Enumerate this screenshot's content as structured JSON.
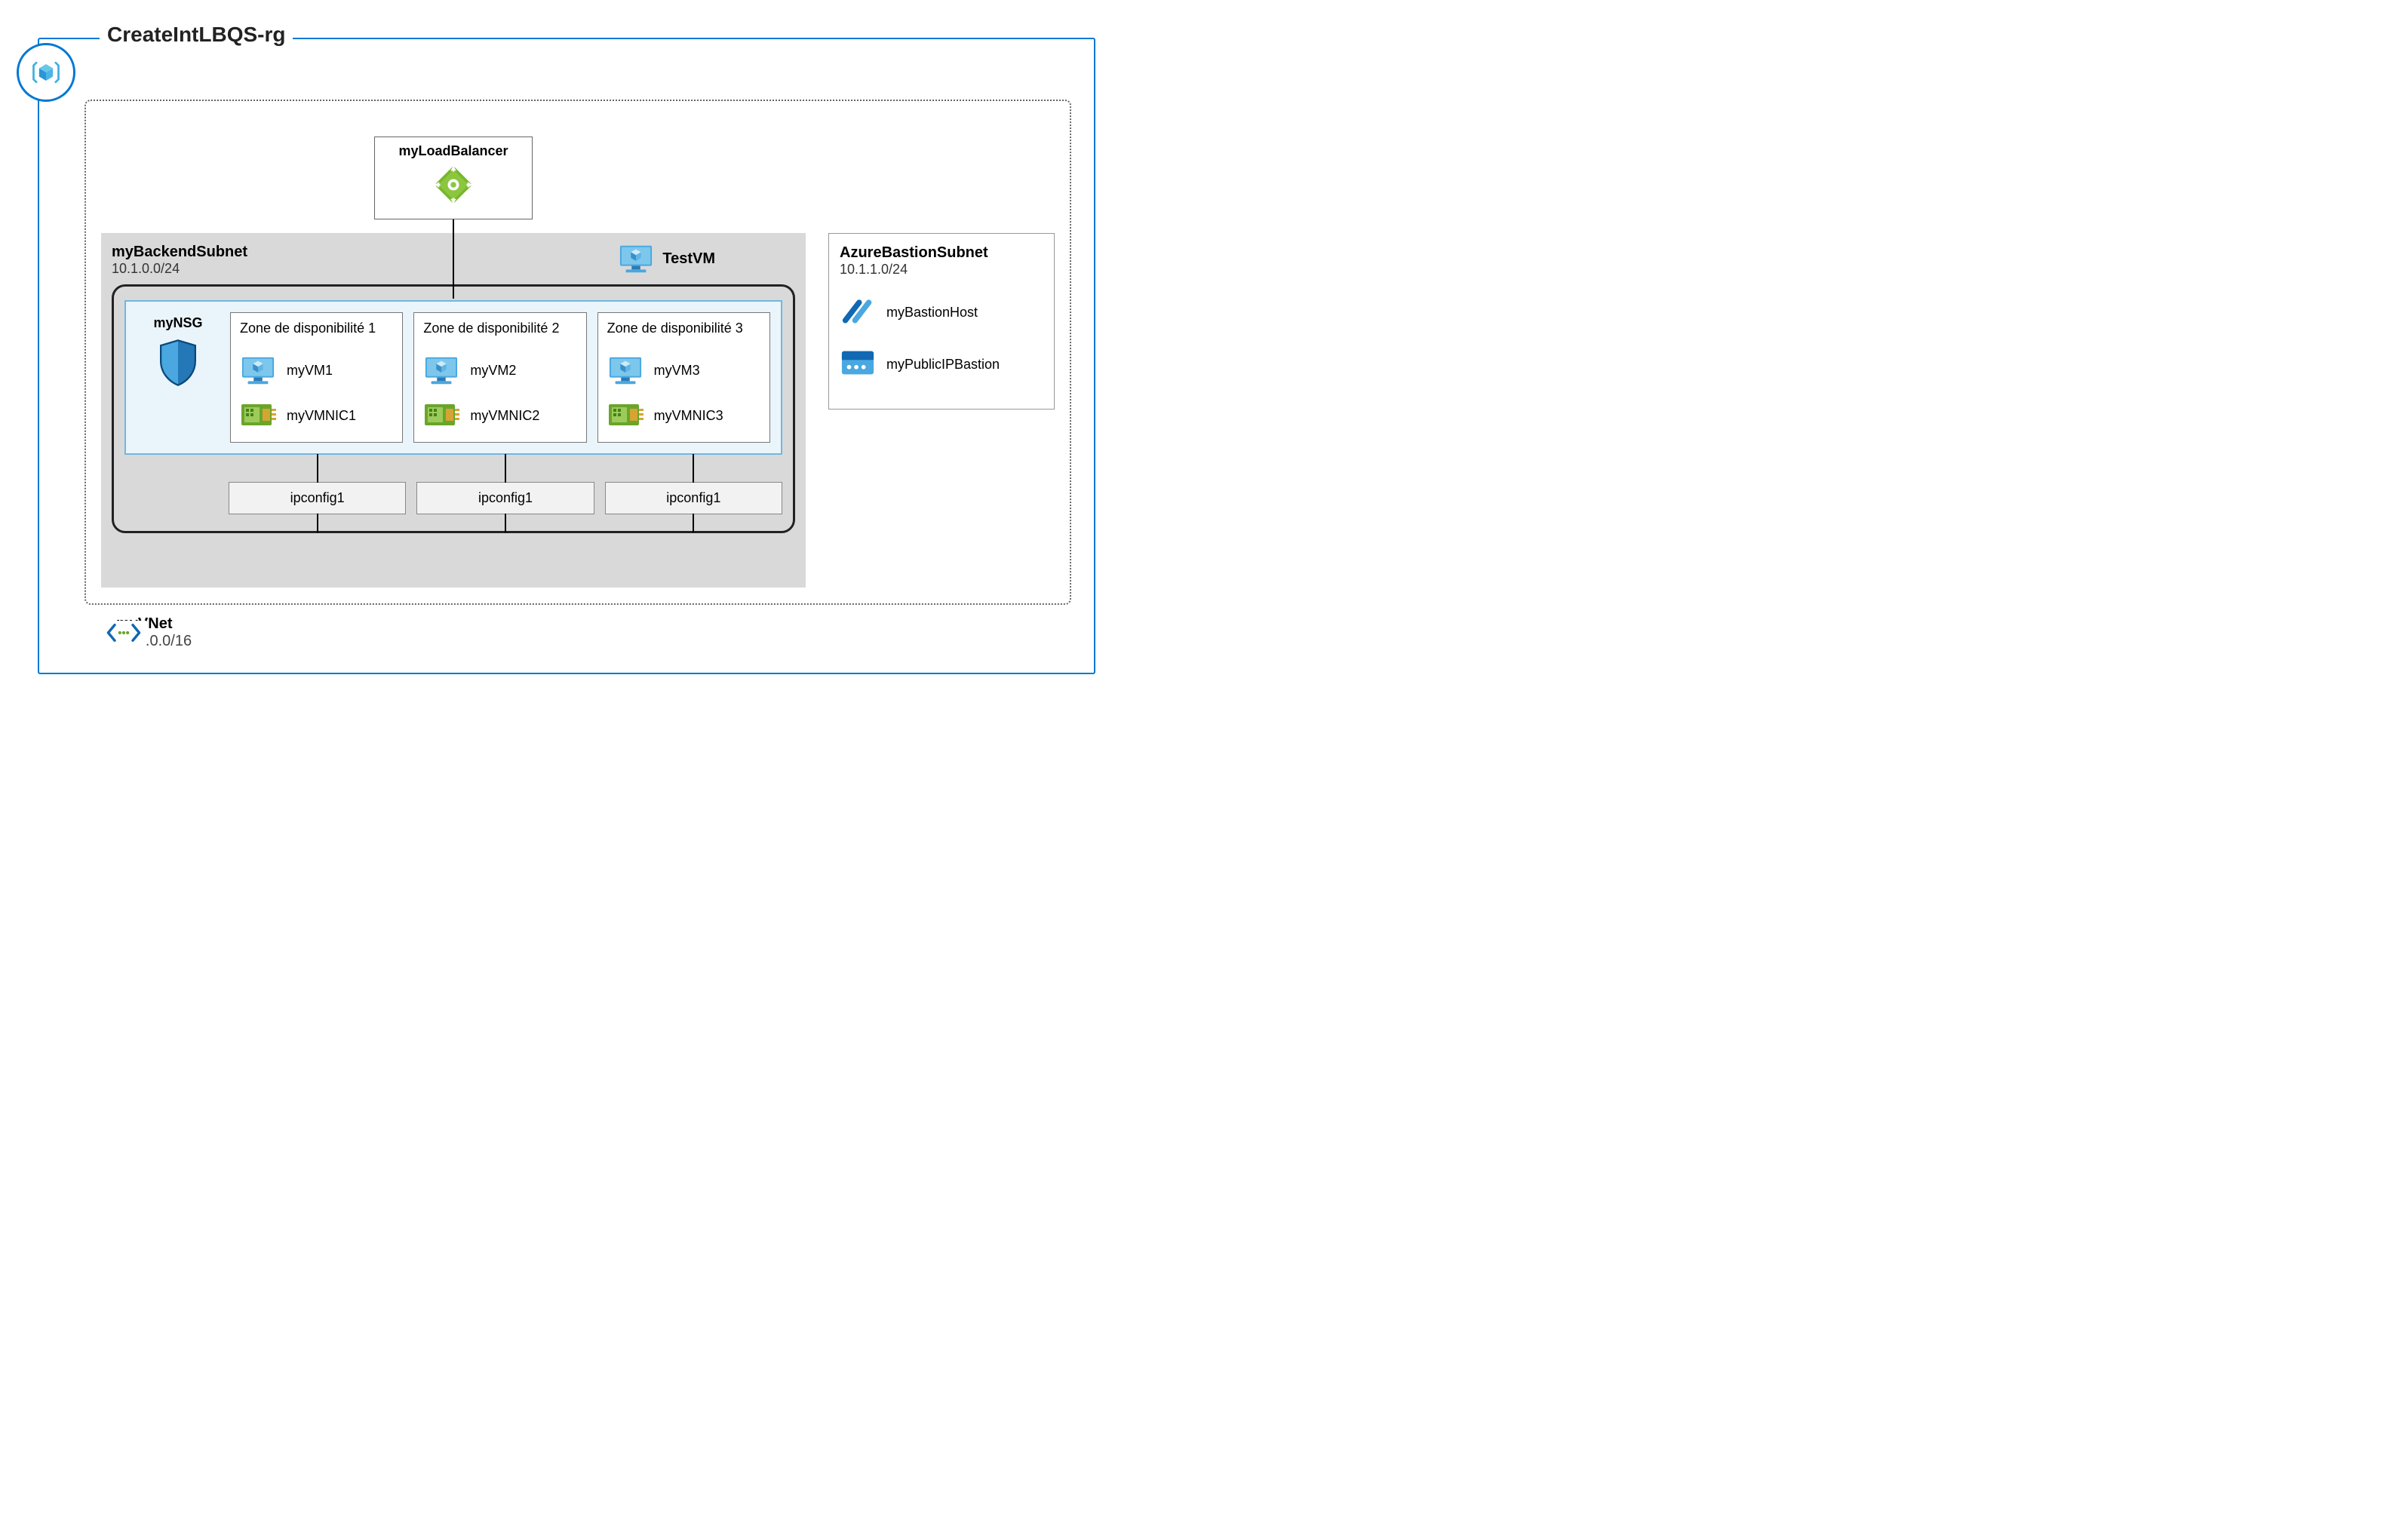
{
  "resourceGroup": {
    "name": "CreateIntLBQS-rg"
  },
  "loadBalancer": {
    "name": "myLoadBalancer"
  },
  "vnet": {
    "name": "myVNet",
    "cidr": "10.1.0.0/16"
  },
  "backendSubnet": {
    "name": "myBackendSubnet",
    "cidr": "10.1.0.0/24"
  },
  "testVM": {
    "name": "TestVM"
  },
  "nsg": {
    "name": "myNSG"
  },
  "availabilityZones": [
    {
      "title": "Zone de disponibilité 1",
      "vm": "myVM1",
      "nic": "myVMNIC1",
      "ipconfig": "ipconfig1"
    },
    {
      "title": "Zone de disponibilité 2",
      "vm": "myVM2",
      "nic": "myVMNIC2",
      "ipconfig": "ipconfig1"
    },
    {
      "title": "Zone de disponibilité 3",
      "vm": "myVM3",
      "nic": "myVMNIC3",
      "ipconfig": "ipconfig1"
    }
  ],
  "bastionSubnet": {
    "name": "AzureBastionSubnet",
    "cidr": "10.1.1.0/24"
  },
  "bastionHost": {
    "name": "myBastionHost"
  },
  "publicIpBastion": {
    "name": "myPublicIPBastion"
  }
}
